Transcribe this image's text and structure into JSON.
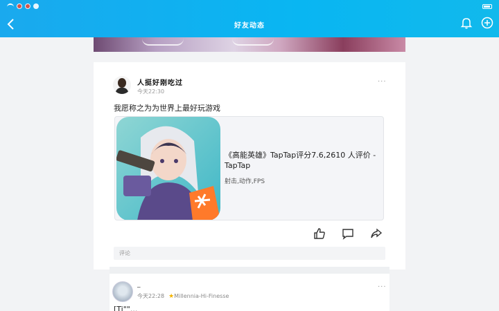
{
  "header": {
    "title": "好友动态"
  },
  "post": {
    "author": "人挺好刚吃过",
    "time": "今天22:30",
    "more": "···",
    "text": "我愿称之为为世界上最好玩游戏",
    "link": {
      "title": "《高能英雄》TapTap评分7.6,2610 人评价 - TapTap",
      "tags": "射击,动作,FPS"
    },
    "comment_placeholder": "评论"
  },
  "post2": {
    "author": "_",
    "time": "今天22:28",
    "badge": "Millennia-Hi-Finesse",
    "more": "···",
    "text": "[Ti\"\"..."
  },
  "colors": {
    "header_start": "#1aa9ee",
    "header_end": "#11b9ec",
    "background": "#f2f3f5"
  }
}
